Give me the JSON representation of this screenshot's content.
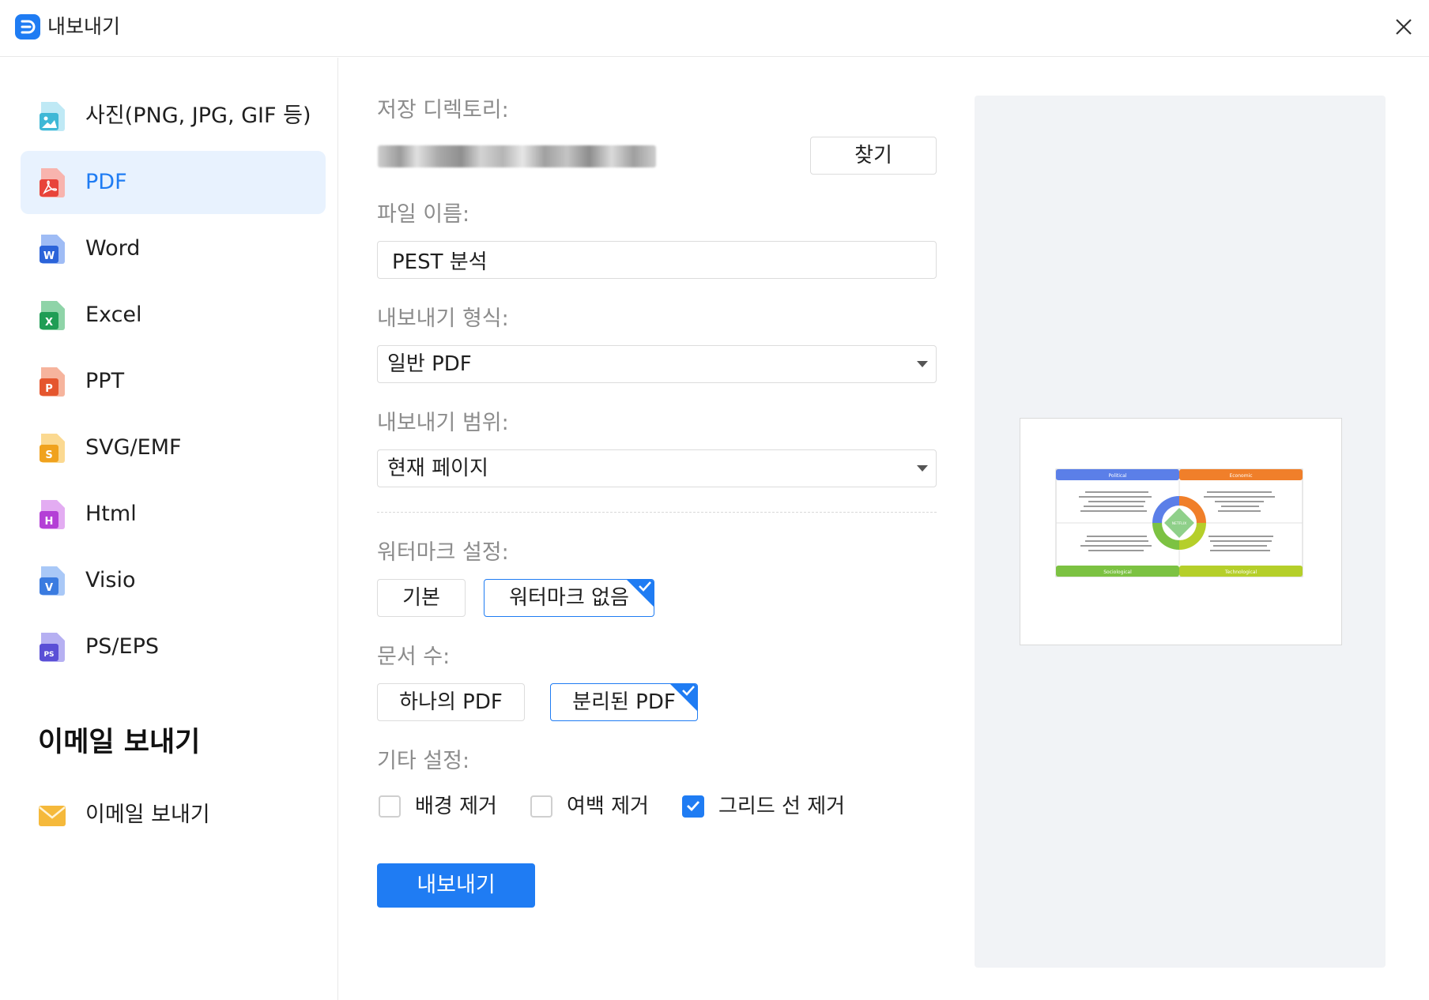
{
  "window": {
    "title": "내보내기",
    "close_icon": "close-icon"
  },
  "sidebar": {
    "items": [
      {
        "label": "사진(PNG, JPG, GIF 등)",
        "icon": "image-file-icon",
        "color": "#3fb8d6",
        "active": false
      },
      {
        "label": "PDF",
        "icon": "pdf-file-icon",
        "color": "#e8443a",
        "active": true
      },
      {
        "label": "Word",
        "icon": "word-file-icon",
        "color": "#2b63d9",
        "active": false
      },
      {
        "label": "Excel",
        "icon": "excel-file-icon",
        "color": "#1f9d55",
        "active": false
      },
      {
        "label": "PPT",
        "icon": "ppt-file-icon",
        "color": "#e5562e",
        "active": false
      },
      {
        "label": "SVG/EMF",
        "icon": "svg-file-icon",
        "color": "#f0a21e",
        "active": false
      },
      {
        "label": "Html",
        "icon": "html-file-icon",
        "color": "#b43fd6",
        "active": false
      },
      {
        "label": "Visio",
        "icon": "visio-file-icon",
        "color": "#3a7be0",
        "active": false
      },
      {
        "label": "PS/EPS",
        "icon": "ps-file-icon",
        "color": "#5a4fd6",
        "active": false
      }
    ],
    "email_heading": "이메일 보내기",
    "email_item": {
      "label": "이메일 보내기",
      "icon": "envelope-icon",
      "color": "#f5b93b"
    }
  },
  "form": {
    "save_dir_label": "저장 디렉토리:",
    "browse_label": "찾기",
    "file_name_label": "파일 이름:",
    "file_name_value": "PEST 분석",
    "format_label": "내보내기 형식:",
    "format_value": "일반 PDF",
    "range_label": "내보내기 범위:",
    "range_value": "현재 페이지",
    "watermark_label": "워터마크 설정:",
    "watermark_options": [
      "기본",
      "워터마크 없음"
    ],
    "watermark_selected": 1,
    "doc_count_label": "문서 수:",
    "doc_count_options": [
      "하나의 PDF",
      "분리된 PDF"
    ],
    "doc_count_selected": 1,
    "other_label": "기타 설정:",
    "checkboxes": [
      {
        "label": "배경 제거",
        "checked": false
      },
      {
        "label": "여백 제거",
        "checked": false
      },
      {
        "label": "그리드 선 제거",
        "checked": true
      }
    ],
    "export_label": "내보내기"
  },
  "preview": {
    "quadrants": [
      "Political",
      "Economic",
      "Sociological",
      "Technological"
    ],
    "center_label": "NETFLIX",
    "ring_letters": [
      "P",
      "E",
      "S",
      "T"
    ],
    "colors": {
      "political": "#5b7fe8",
      "economic": "#f07f2a",
      "sociological": "#7cc242",
      "technological": "#b5cf2a"
    }
  },
  "colors": {
    "accent": "#1f7cf3",
    "active_bg": "#e8f2fe"
  }
}
